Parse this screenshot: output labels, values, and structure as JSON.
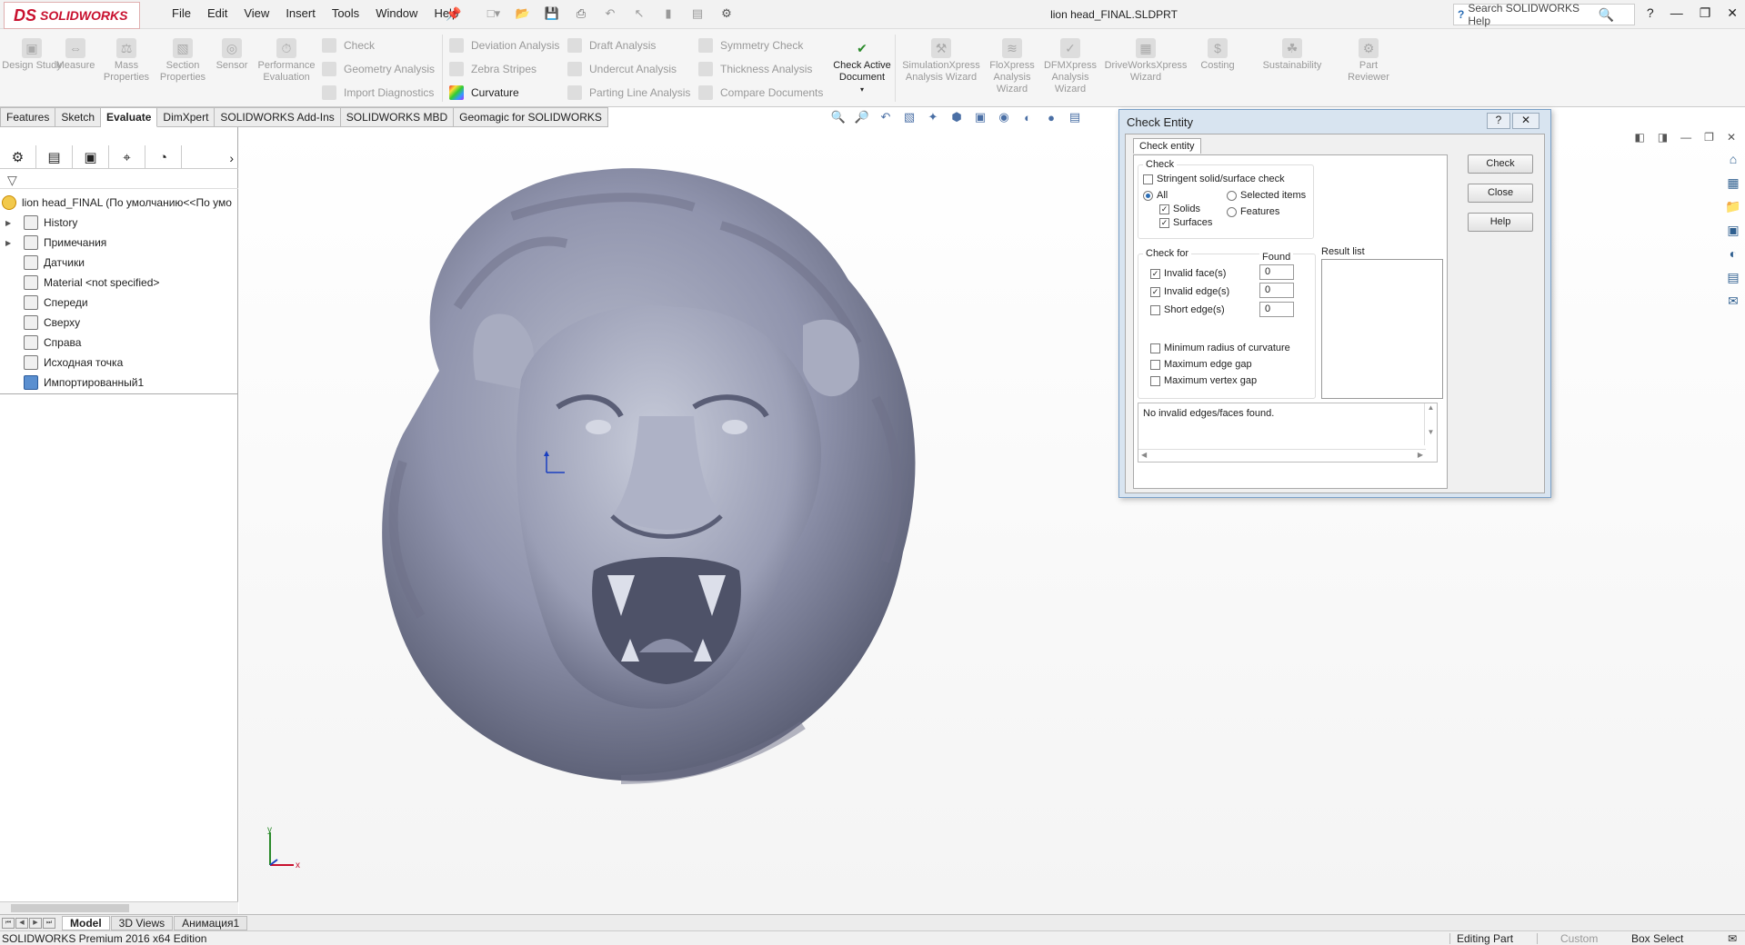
{
  "app": {
    "logo_ds": "DS",
    "logo_text": "SOLIDWORKS",
    "document_title": "lion head_FINAL.SLDPRT",
    "search_placeholder": "Search SOLIDWORKS Help"
  },
  "menu": [
    "File",
    "Edit",
    "View",
    "Insert",
    "Tools",
    "Window",
    "Help"
  ],
  "command_manager": {
    "big_tools": [
      {
        "label": "Design Study"
      },
      {
        "label": "Measure"
      },
      {
        "label": "Mass Properties"
      },
      {
        "label": "Section Properties"
      },
      {
        "label": "Sensor"
      },
      {
        "label": "Performance Evaluation"
      }
    ],
    "small_tools": [
      {
        "label": "Check"
      },
      {
        "label": "Geometry Analysis"
      },
      {
        "label": "Import Diagnostics"
      },
      {
        "label": "Deviation Analysis"
      },
      {
        "label": "Zebra Stripes"
      },
      {
        "label": "Curvature"
      },
      {
        "label": "Draft Analysis"
      },
      {
        "label": "Undercut Analysis"
      },
      {
        "label": "Parting Line Analysis"
      },
      {
        "label": "Symmetry Check"
      },
      {
        "label": "Thickness Analysis"
      },
      {
        "label": "Compare Documents"
      }
    ],
    "check_active": "Check Active Document",
    "wizards": [
      {
        "label": "SimulationXpress Analysis Wizard"
      },
      {
        "label": "FloXpress Analysis Wizard"
      },
      {
        "label": "DFMXpress Analysis Wizard"
      },
      {
        "label": "DriveWorksXpress Wizard"
      },
      {
        "label": "Costing"
      },
      {
        "label": "Sustainability"
      },
      {
        "label": "Part Reviewer"
      }
    ]
  },
  "tabs": [
    {
      "label": "Features"
    },
    {
      "label": "Sketch"
    },
    {
      "label": "Evaluate",
      "active": true
    },
    {
      "label": "DimXpert"
    },
    {
      "label": "SOLIDWORKS Add-Ins"
    },
    {
      "label": "SOLIDWORKS MBD"
    },
    {
      "label": "Geomagic for SOLIDWORKS"
    }
  ],
  "feature_tree": {
    "root": "lion head_FINAL  (По умолчанию<<По умо",
    "items": [
      {
        "label": "History",
        "expandable": true
      },
      {
        "label": "Примечания",
        "expandable": true
      },
      {
        "label": "Датчики",
        "expandable": false
      },
      {
        "label": "Material <not specified>",
        "expandable": false
      },
      {
        "label": "Спереди",
        "expandable": false
      },
      {
        "label": "Сверху",
        "expandable": false
      },
      {
        "label": "Справа",
        "expandable": false
      },
      {
        "label": "Исходная точка",
        "expandable": false
      },
      {
        "label": "Импортированный1",
        "expandable": false
      }
    ]
  },
  "dialog": {
    "title": "Check Entity",
    "tab": "Check entity",
    "check_group": "Check",
    "stringent": {
      "label": "Stringent solid/surface check",
      "checked": false
    },
    "scope": {
      "all": {
        "label": "All",
        "selected": true
      },
      "selected_items": {
        "label": "Selected items",
        "selected": false
      },
      "features": {
        "label": "Features",
        "selected": false
      }
    },
    "solids": {
      "label": "Solids",
      "checked": true
    },
    "surfaces": {
      "label": "Surfaces",
      "checked": true
    },
    "check_for_group": "Check for",
    "found_header": "Found",
    "checks": [
      {
        "label": "Invalid face(s)",
        "checked": true,
        "found": "0"
      },
      {
        "label": "Invalid edge(s)",
        "checked": true,
        "found": "0"
      },
      {
        "label": "Short edge(s)",
        "checked": false,
        "found": "0"
      }
    ],
    "extra_checks": [
      {
        "label": "Minimum radius of curvature",
        "checked": false
      },
      {
        "label": "Maximum edge gap",
        "checked": false
      },
      {
        "label": "Maximum vertex gap",
        "checked": false
      }
    ],
    "result_list_label": "Result list",
    "message": "No invalid edges/faces found.",
    "buttons": {
      "check": "Check",
      "close": "Close",
      "help": "Help"
    }
  },
  "bottom_tabs": [
    {
      "label": "Model",
      "active": true
    },
    {
      "label": "3D Views"
    },
    {
      "label": "Анимация1"
    }
  ],
  "status": {
    "edition": "SOLIDWORKS Premium 2016 x64 Edition",
    "editing": "Editing Part",
    "units": "Custom",
    "select": "Box Select"
  },
  "triad": {
    "x": "x",
    "y": "y"
  },
  "colors": {
    "accent": "#c8102e",
    "model": "#9a9eb8",
    "dialog_frame": "#7aa0c8"
  }
}
